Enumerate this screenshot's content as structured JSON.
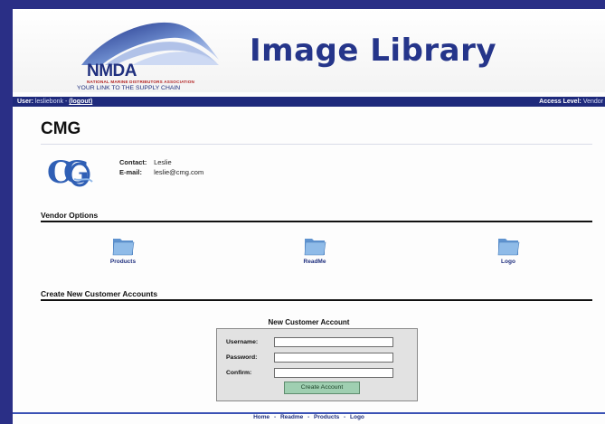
{
  "header": {
    "logo": {
      "name": "NMDA",
      "association": "NATIONAL MARINE DISTRIBUTORS ASSOCIATION",
      "tagline": "YOUR LINK TO THE SUPPLY CHAIN"
    },
    "title": "Image Library"
  },
  "userbar": {
    "user_label": "User:",
    "username": "lesliebonk",
    "separator": "-",
    "logout_label": "(logout)",
    "access_label": "Access Level:",
    "access_value": "Vendor"
  },
  "company": {
    "name": "CMG",
    "logo_text": "CMG",
    "contact_label": "Contact:",
    "contact_value": "Leslie",
    "email_label": "E-mail:",
    "email_value": "leslie@cmg.com"
  },
  "vendor_options": {
    "title": "Vendor Options",
    "items": [
      {
        "label": "Products",
        "icon": "folder-icon"
      },
      {
        "label": "ReadMe",
        "icon": "folder-icon"
      },
      {
        "label": "Logo",
        "icon": "folder-icon"
      }
    ]
  },
  "create_accounts": {
    "title": "Create New Customer Accounts",
    "form_title": "New Customer Account",
    "fields": [
      {
        "label": "Username:",
        "value": ""
      },
      {
        "label": "Password:",
        "value": ""
      },
      {
        "label": "Confirm:",
        "value": ""
      }
    ],
    "submit_label": "Create Account"
  },
  "footer": {
    "links": [
      "Home",
      "Readme",
      "Products",
      "Logo"
    ],
    "separator": "-"
  },
  "colors": {
    "frame": "#2a2f86",
    "brand_blue": "#25358a",
    "userbar": "#1f2a7c",
    "button": "#9fcfb1",
    "folder": "#7fb0dd"
  }
}
